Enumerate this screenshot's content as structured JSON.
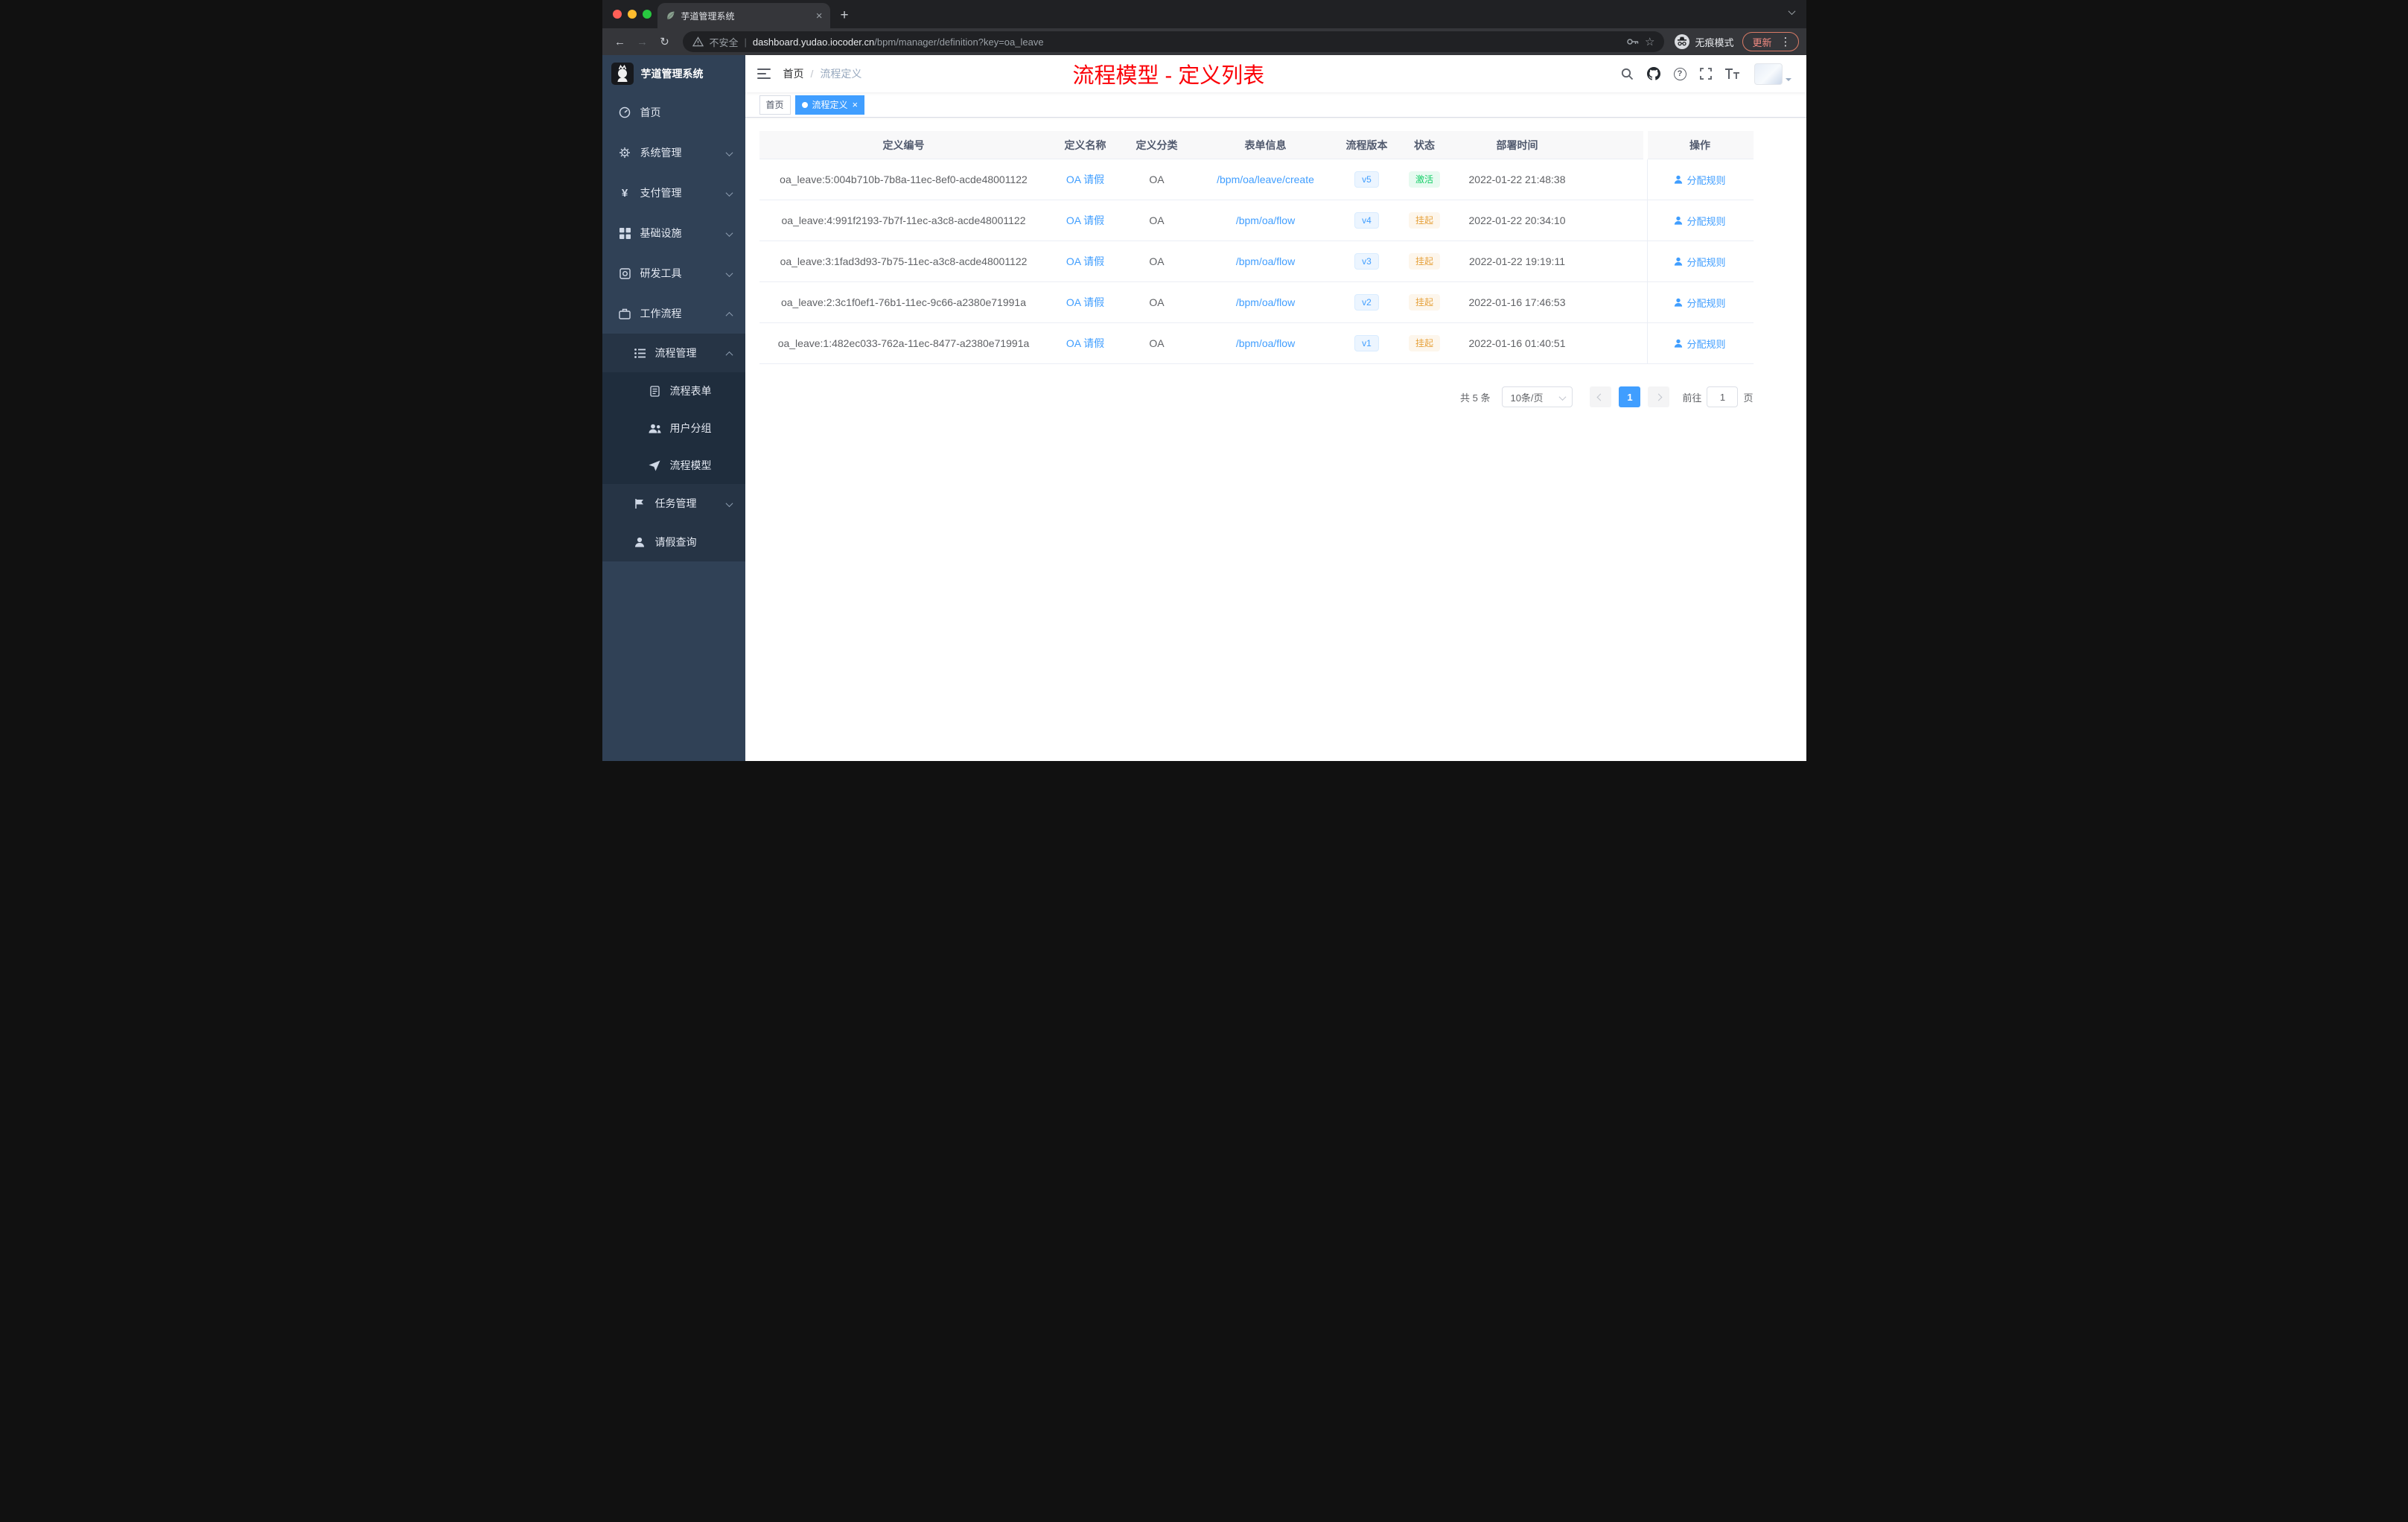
{
  "browser": {
    "tab_title": "芋道管理系统",
    "not_secure": "不安全",
    "url_domain": "dashboard.yudao.iocoder.cn",
    "url_path": "/bpm/manager/definition?key=oa_leave",
    "incognito": "无痕模式",
    "update": "更新"
  },
  "icons": {
    "close": "×",
    "new_tab": "+",
    "back": "←",
    "forward": "→",
    "reload": "↻",
    "star": "☆",
    "more": "⋮",
    "help": "?",
    "pipe": "|",
    "slash": "/"
  },
  "sidebar": {
    "title": "芋道管理系统",
    "items": [
      {
        "label": "首页"
      },
      {
        "label": "系统管理"
      },
      {
        "label": "支付管理"
      },
      {
        "label": "基础设施"
      },
      {
        "label": "研发工具"
      },
      {
        "label": "工作流程"
      },
      {
        "label": "流程管理"
      },
      {
        "label": "流程表单"
      },
      {
        "label": "用户分组"
      },
      {
        "label": "流程模型"
      },
      {
        "label": "任务管理"
      },
      {
        "label": "请假查询"
      }
    ]
  },
  "header": {
    "breadcrumb_home": "首页",
    "breadcrumb_current": "流程定义",
    "annotation": "流程模型 - 定义列表"
  },
  "tags": {
    "home": "首页",
    "active": "流程定义"
  },
  "table": {
    "columns": [
      "定义编号",
      "定义名称",
      "定义分类",
      "表单信息",
      "流程版本",
      "状态",
      "部署时间",
      "操作"
    ],
    "rows": [
      {
        "id": "oa_leave:5:004b710b-7b8a-11ec-8ef0-acde48001122",
        "name": "OA 请假",
        "category": "OA",
        "form": "/bpm/oa/leave/create",
        "version": "v5",
        "status": "激活",
        "time": "2022-01-22 21:48:38",
        "action": "分配规则"
      },
      {
        "id": "oa_leave:4:991f2193-7b7f-11ec-a3c8-acde48001122",
        "name": "OA 请假",
        "category": "OA",
        "form": "/bpm/oa/flow",
        "version": "v4",
        "status": "挂起",
        "time": "2022-01-22 20:34:10",
        "action": "分配规则"
      },
      {
        "id": "oa_leave:3:1fad3d93-7b75-11ec-a3c8-acde48001122",
        "name": "OA 请假",
        "category": "OA",
        "form": "/bpm/oa/flow",
        "version": "v3",
        "status": "挂起",
        "time": "2022-01-22 19:19:11",
        "action": "分配规则"
      },
      {
        "id": "oa_leave:2:3c1f0ef1-76b1-11ec-9c66-a2380e71991a",
        "name": "OA 请假",
        "category": "OA",
        "form": "/bpm/oa/flow",
        "version": "v2",
        "status": "挂起",
        "time": "2022-01-16 17:46:53",
        "action": "分配规则"
      },
      {
        "id": "oa_leave:1:482ec033-762a-11ec-8477-a2380e71991a",
        "name": "OA 请假",
        "category": "OA",
        "form": "/bpm/oa/flow",
        "version": "v1",
        "status": "挂起",
        "time": "2022-01-16 01:40:51",
        "action": "分配规则"
      }
    ]
  },
  "pagination": {
    "total": "共 5 条",
    "page_size": "10条/页",
    "current": "1",
    "goto": "前往",
    "goto_value": "1",
    "unit": "页"
  },
  "colors": {
    "accent": "#409eff",
    "success": "#13ce66",
    "warning": "#e6a23c",
    "annotation": "#fb0007",
    "sidebar_bg": "#304156",
    "sidebar_sub_bg": "#1f2d3d"
  }
}
